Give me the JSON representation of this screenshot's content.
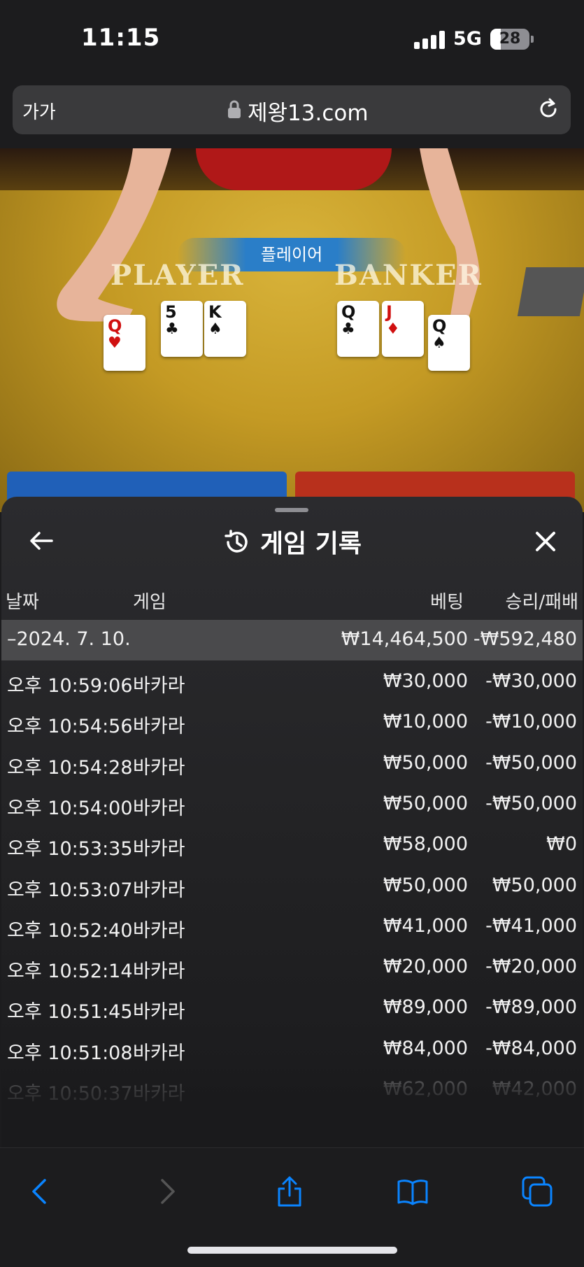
{
  "status_bar": {
    "time": "11:15",
    "network": "5G",
    "battery": "28"
  },
  "address_bar": {
    "text_size_label": "가가",
    "url": "제왕13.com"
  },
  "game": {
    "result_banner": "플레이어",
    "player_label": "PLAYER",
    "banker_label": "BANKER",
    "player_cards": [
      {
        "rank": "Q",
        "suit": "♥",
        "color": "red"
      },
      {
        "rank": "5",
        "suit": "♣",
        "color": "black"
      },
      {
        "rank": "K",
        "suit": "♠",
        "color": "black"
      }
    ],
    "banker_cards": [
      {
        "rank": "Q",
        "suit": "♣",
        "color": "black"
      },
      {
        "rank": "J",
        "suit": "♦",
        "color": "red"
      },
      {
        "rank": "Q",
        "suit": "♠",
        "color": "black"
      }
    ]
  },
  "history": {
    "title": "게임 기록",
    "columns": {
      "date": "날짜",
      "game": "게임",
      "bet": "베팅",
      "result": "승리/패배"
    },
    "summary": {
      "date": "–2024. 7. 10.",
      "bet": "₩14,464,500",
      "result": "-₩592,480"
    },
    "rows": [
      {
        "time": "오후 10:59:06",
        "game": "바카라",
        "bet": "₩30,000",
        "result": "-₩30,000"
      },
      {
        "time": "오후 10:54:56",
        "game": "바카라",
        "bet": "₩10,000",
        "result": "-₩10,000"
      },
      {
        "time": "오후 10:54:28",
        "game": "바카라",
        "bet": "₩50,000",
        "result": "-₩50,000"
      },
      {
        "time": "오후 10:54:00",
        "game": "바카라",
        "bet": "₩50,000",
        "result": "-₩50,000"
      },
      {
        "time": "오후 10:53:35",
        "game": "바카라",
        "bet": "₩58,000",
        "result": "₩0"
      },
      {
        "time": "오후 10:53:07",
        "game": "바카라",
        "bet": "₩50,000",
        "result": "₩50,000"
      },
      {
        "time": "오후 10:52:40",
        "game": "바카라",
        "bet": "₩41,000",
        "result": "-₩41,000"
      },
      {
        "time": "오후 10:52:14",
        "game": "바카라",
        "bet": "₩20,000",
        "result": "-₩20,000"
      },
      {
        "time": "오후 10:51:45",
        "game": "바카라",
        "bet": "₩89,000",
        "result": "-₩89,000"
      },
      {
        "time": "오후 10:51:08",
        "game": "바카라",
        "bet": "₩84,000",
        "result": "-₩84,000"
      },
      {
        "time": "오후 10:50:37",
        "game": "바카라",
        "bet": "₩62,000",
        "result": "₩42,000"
      }
    ]
  },
  "colors": {
    "accent": "#0a84ff",
    "sheet_bg": "#232325",
    "summary_row": "#4a4a4c"
  }
}
